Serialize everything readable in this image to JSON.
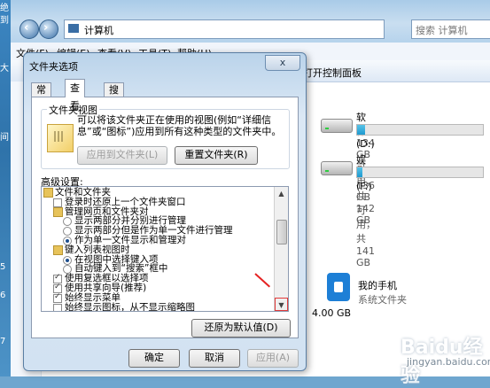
{
  "desktop": {
    "chars": [
      "绝",
      "到",
      "大",
      "间",
      "5",
      "6",
      "7"
    ]
  },
  "explorer": {
    "address_text": "计算机",
    "search_placeholder": "搜索 计算机",
    "menu": [
      "文件(F)",
      "编辑(E)",
      "查看(V)",
      "工具(T)",
      "帮助(H)"
    ],
    "command_control_panel": "打开控制面板",
    "drives": [
      {
        "name": "软件 (D:)",
        "info": "134 GB 可用，共 142 GB",
        "used_fraction": 0.06
      },
      {
        "name": "娱乐 (F:)",
        "info": "136 GB 可用，共 141 GB",
        "used_fraction": 0.04
      }
    ],
    "phone": {
      "name": "我的手机",
      "type": "系统文件夹"
    },
    "memory": "4.00 GB"
  },
  "dialog": {
    "title": "文件夹选项",
    "close_label": "x",
    "tabs": [
      "常规",
      "查看",
      "搜索"
    ],
    "active_tab": 1,
    "folder_view": {
      "title": "文件夹视图",
      "description": "可以将该文件夹正在使用的视图(例如“详细信息”或“图标”)应用到所有这种类型的文件夹中。",
      "apply_button": "应用到文件夹(L)",
      "reset_button": "重置文件夹(R)"
    },
    "advanced_label": "高级设置:",
    "tree": [
      {
        "kind": "folder",
        "indent": 0,
        "label": "文件和文件夹"
      },
      {
        "kind": "checkbox",
        "indent": 1,
        "checked": false,
        "label": "登录时还原上一个文件夹窗口"
      },
      {
        "kind": "folder",
        "indent": 1,
        "label": "管理网页和文件夹对"
      },
      {
        "kind": "radio",
        "indent": 2,
        "checked": false,
        "label": "显示两部分并分别进行管理"
      },
      {
        "kind": "radio",
        "indent": 2,
        "checked": false,
        "label": "显示两部分但是作为单一文件进行管理"
      },
      {
        "kind": "radio",
        "indent": 2,
        "checked": true,
        "label": "作为单一文件显示和管理对"
      },
      {
        "kind": "folder",
        "indent": 1,
        "label": "键入列表视图时"
      },
      {
        "kind": "radio",
        "indent": 2,
        "checked": true,
        "label": "在视图中选择键入项"
      },
      {
        "kind": "radio",
        "indent": 2,
        "checked": false,
        "label": "自动键入到“搜索”框中"
      },
      {
        "kind": "checkbox",
        "indent": 1,
        "checked": true,
        "label": "使用复选框以选择项"
      },
      {
        "kind": "checkbox",
        "indent": 1,
        "checked": true,
        "label": "使用共享向导(推荐)"
      },
      {
        "kind": "checkbox",
        "indent": 1,
        "checked": true,
        "label": "始终显示菜单"
      },
      {
        "kind": "checkbox",
        "indent": 1,
        "checked": false,
        "label": "始终显示图标，从不显示缩略图"
      }
    ],
    "restore_button": "还原为默认值(D)",
    "ok_button": "确定",
    "cancel_button": "取消",
    "apply_button": "应用(A)"
  },
  "watermark": {
    "logo": "Baidu经验",
    "url": "jingyan.baidu.com"
  }
}
